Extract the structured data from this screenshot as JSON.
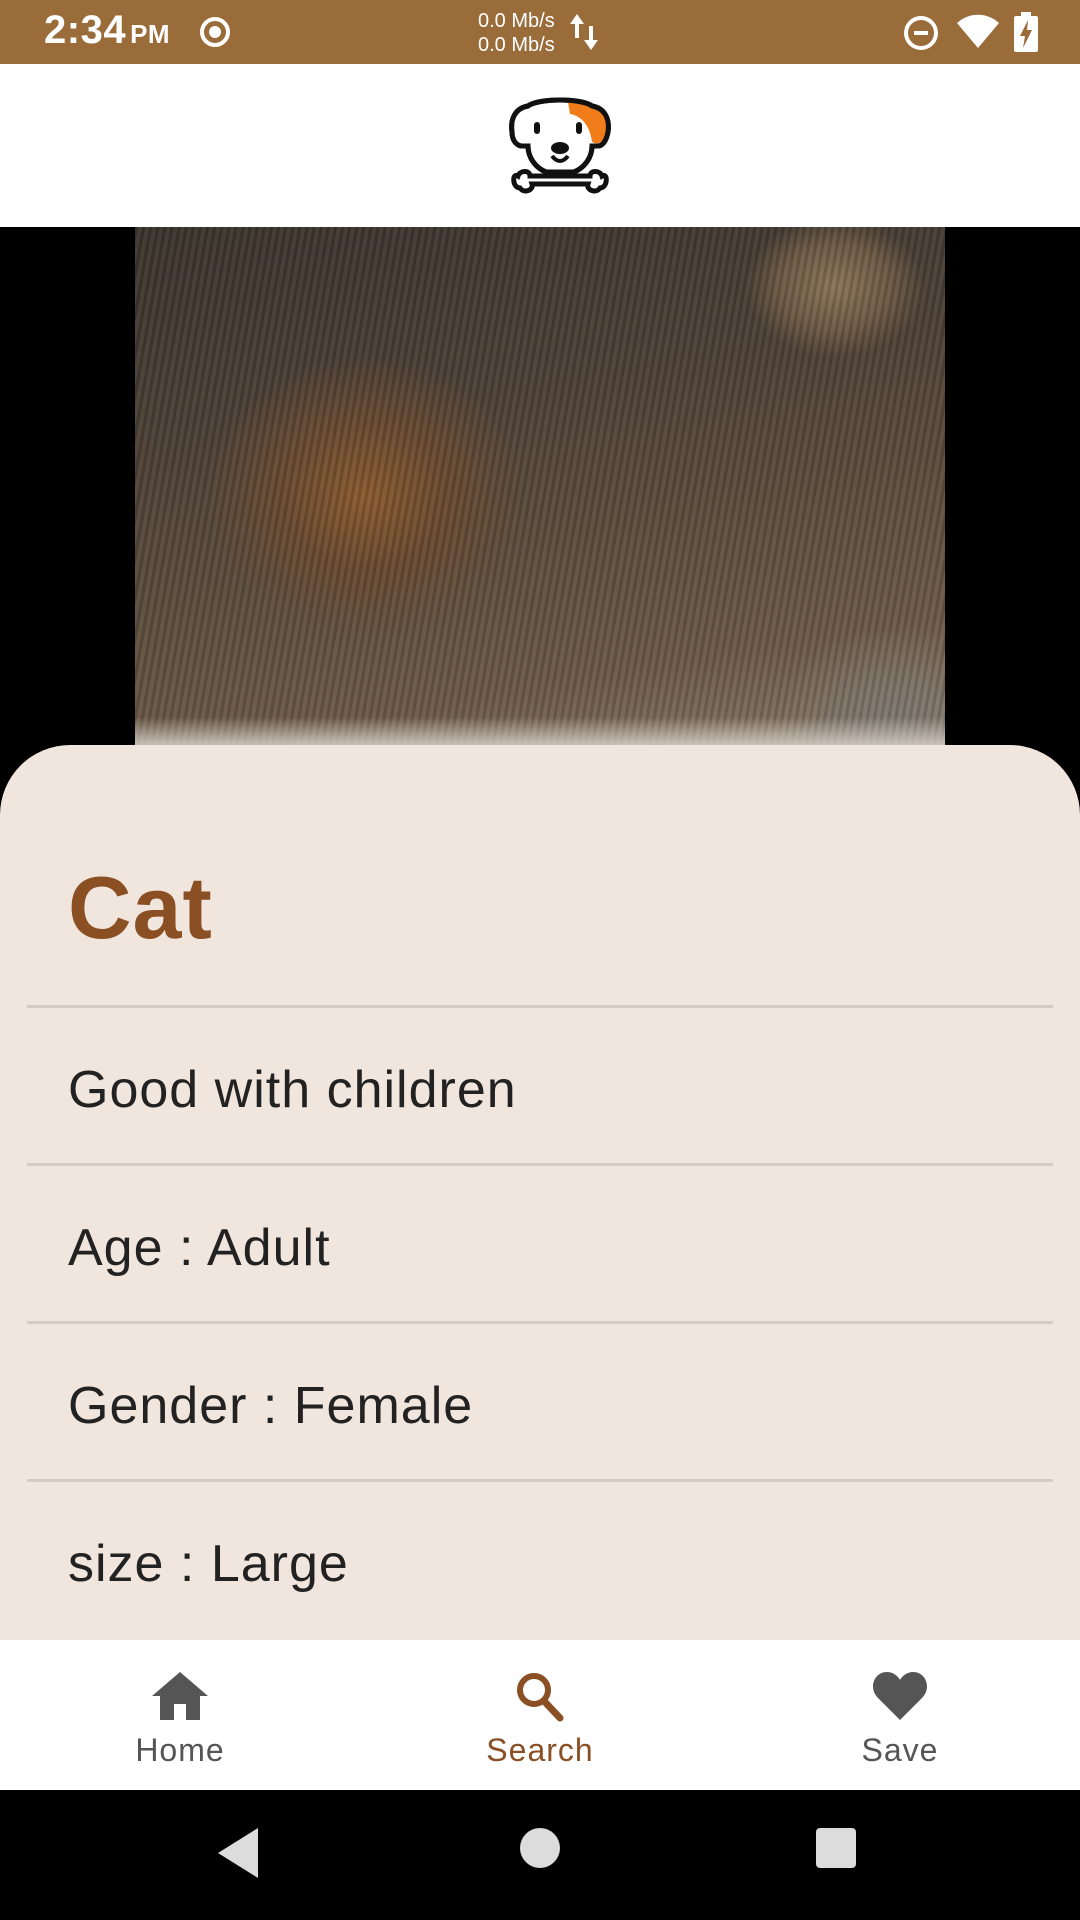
{
  "status_bar": {
    "time": "2:34",
    "ampm": "PM",
    "net_up": "0.0 Mb/s",
    "net_down": "0.0 Mb/s",
    "icons": [
      "record-icon",
      "data-arrows-icon",
      "do-not-disturb-icon",
      "wifi-icon",
      "battery-charging-icon"
    ]
  },
  "header": {
    "logo": "dog-logo-icon"
  },
  "pet": {
    "name": "Cat",
    "details": [
      "Good with children",
      "Age : Adult",
      "Gender : Female",
      "size : Large"
    ]
  },
  "bottom_nav": {
    "items": [
      {
        "label": "Home",
        "icon": "home-icon",
        "active": false
      },
      {
        "label": "Search",
        "icon": "search-icon",
        "active": true
      },
      {
        "label": "Save",
        "icon": "heart-icon",
        "active": false
      }
    ]
  },
  "colors": {
    "status_bar": "#9a6c3a",
    "accent": "#8b4f24",
    "sheet": "#f0e6de",
    "logo_orange": "#f07d1a"
  }
}
